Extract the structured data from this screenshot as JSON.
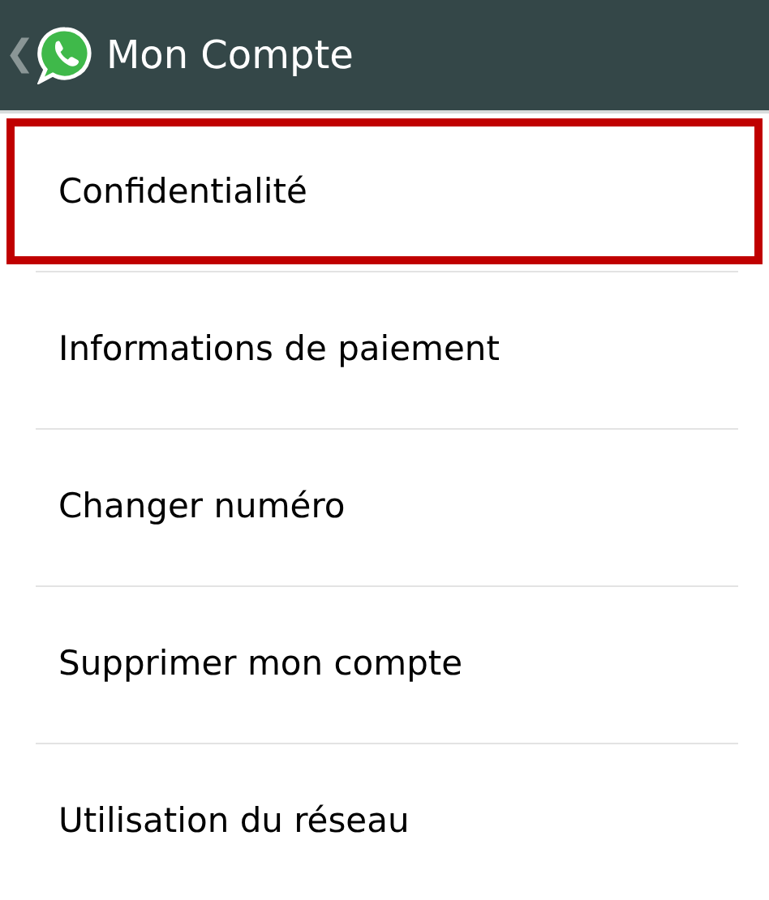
{
  "header": {
    "back": "❮",
    "title": "Mon Compte"
  },
  "items": [
    {
      "label": "Confidentialité",
      "highlighted": true
    },
    {
      "label": "Informations de paiement",
      "highlighted": false
    },
    {
      "label": "Changer numéro",
      "highlighted": false
    },
    {
      "label": "Supprimer mon compte",
      "highlighted": false
    },
    {
      "label": "Utilisation du réseau",
      "highlighted": false
    }
  ]
}
